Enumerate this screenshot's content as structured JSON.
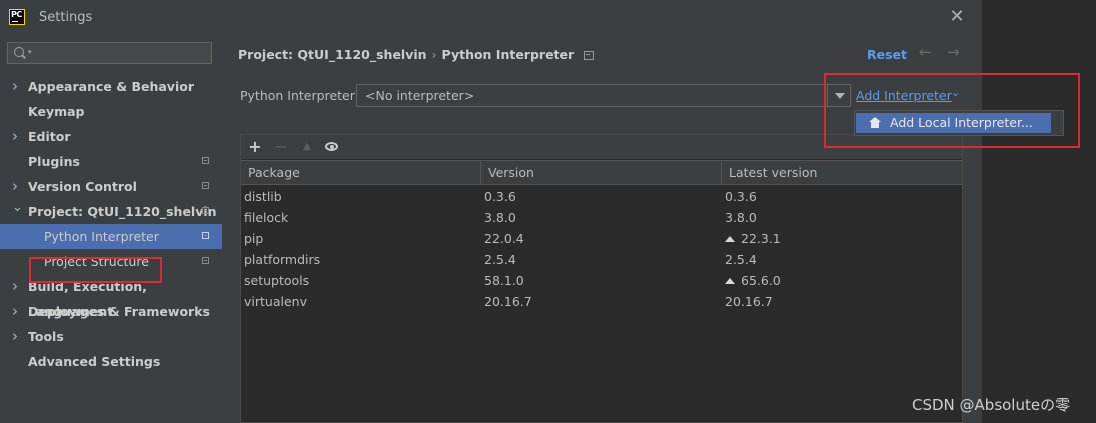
{
  "window": {
    "title": "Settings",
    "app_icon": "PC"
  },
  "search": {
    "placeholder": "",
    "value": ""
  },
  "sidebar": {
    "items": [
      {
        "label": "Appearance & Behavior",
        "expandable": true,
        "bold": true
      },
      {
        "label": "Keymap",
        "expandable": false,
        "bold": true
      },
      {
        "label": "Editor",
        "expandable": true,
        "bold": true
      },
      {
        "label": "Plugins",
        "expandable": false,
        "bold": true,
        "project_icon": true
      },
      {
        "label": "Version Control",
        "expandable": true,
        "bold": true,
        "project_icon": true
      },
      {
        "label": "Project: QtUI_1120_shelvin",
        "expandable": true,
        "expanded": true,
        "bold": true,
        "project_icon": true
      },
      {
        "label": "Python Interpreter",
        "child": true,
        "selected": true,
        "project_icon": true
      },
      {
        "label": "Project Structure",
        "child": true,
        "project_icon": true
      },
      {
        "label": "Build, Execution, Deployment",
        "expandable": true,
        "bold": true
      },
      {
        "label": "Languages & Frameworks",
        "expandable": true,
        "bold": true
      },
      {
        "label": "Tools",
        "expandable": true,
        "bold": true
      },
      {
        "label": "Advanced Settings",
        "expandable": false,
        "bold": true
      }
    ]
  },
  "breadcrumb": {
    "project": "Project: QtUI_1120_shelvin",
    "separator": "›",
    "page": "Python Interpreter"
  },
  "header": {
    "reset_label": "Reset"
  },
  "interpreter": {
    "label": "Python Interpreter:",
    "selected": "<No interpreter>",
    "add_label": "Add Interpreter",
    "menu_items": [
      "Add Local Interpreter..."
    ]
  },
  "packages": {
    "columns": [
      "Package",
      "Version",
      "Latest version"
    ],
    "rows": [
      {
        "name": "distlib",
        "version": "0.3.6",
        "latest": "0.3.6",
        "upgrade": false
      },
      {
        "name": "filelock",
        "version": "3.8.0",
        "latest": "3.8.0",
        "upgrade": false
      },
      {
        "name": "pip",
        "version": "22.0.4",
        "latest": "22.3.1",
        "upgrade": true
      },
      {
        "name": "platformdirs",
        "version": "2.5.4",
        "latest": "2.5.4",
        "upgrade": false
      },
      {
        "name": "setuptools",
        "version": "58.1.0",
        "latest": "65.6.0",
        "upgrade": true
      },
      {
        "name": "virtualenv",
        "version": "20.16.7",
        "latest": "20.16.7",
        "upgrade": false
      }
    ]
  },
  "watermark": "CSDN @Absoluteの零",
  "colors": {
    "accent": "#4b6eaf",
    "link": "#589df6",
    "highlight_box": "#e0282f",
    "background": "#3c3f41"
  }
}
